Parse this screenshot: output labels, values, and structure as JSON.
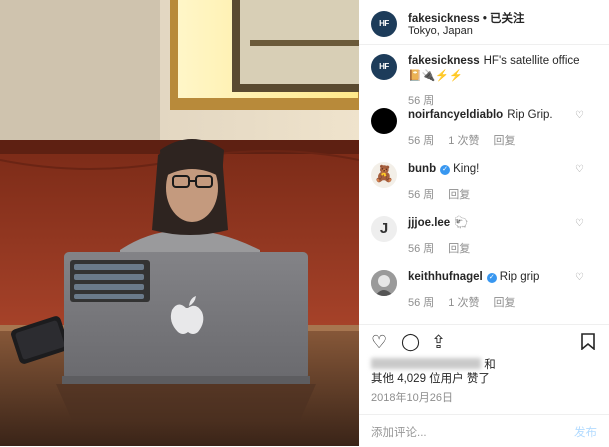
{
  "header": {
    "avatar_text": "HF",
    "username": "fakesickness",
    "follow_label": "• 已关注",
    "location": "Tokyo, Japan"
  },
  "comments": [
    {
      "user": "fakesickness",
      "text": "HF's satellite office",
      "emoji": "📔🔌⚡⚡",
      "time": "56 周",
      "reply": "",
      "likes": "",
      "verified": false,
      "avatar": "brand"
    },
    {
      "user": "noirfancyeldiablo",
      "text": "Rip Grip.",
      "time": "56 周",
      "likes": "1 次赞",
      "reply": "回复",
      "verified": false,
      "avatar": "black"
    },
    {
      "user": "bunb",
      "text": "King!",
      "time": "56 周",
      "likes": "",
      "reply": "回复",
      "verified": true,
      "avatar": "bear"
    },
    {
      "user": "jjjoe.lee",
      "text": "🐑",
      "time": "56 周",
      "likes": "",
      "reply": "回复",
      "verified": false,
      "avatar": "letter"
    },
    {
      "user": "keithhufnagel",
      "text": "Rip grip",
      "time": "56 周",
      "likes": "1 次赞",
      "reply": "回复",
      "verified": true,
      "avatar": "photo"
    }
  ],
  "likes_line1_suffix": "和",
  "likes_line2": "其他 4,029 位用户 赞了",
  "date": "2018年10月26日",
  "add_comment_placeholder": "添加评论...",
  "post_label": "发布",
  "colors": {
    "link_blue": "#3897f0",
    "post_disabled": "#b3dbff",
    "muted": "#8e8e8e"
  }
}
